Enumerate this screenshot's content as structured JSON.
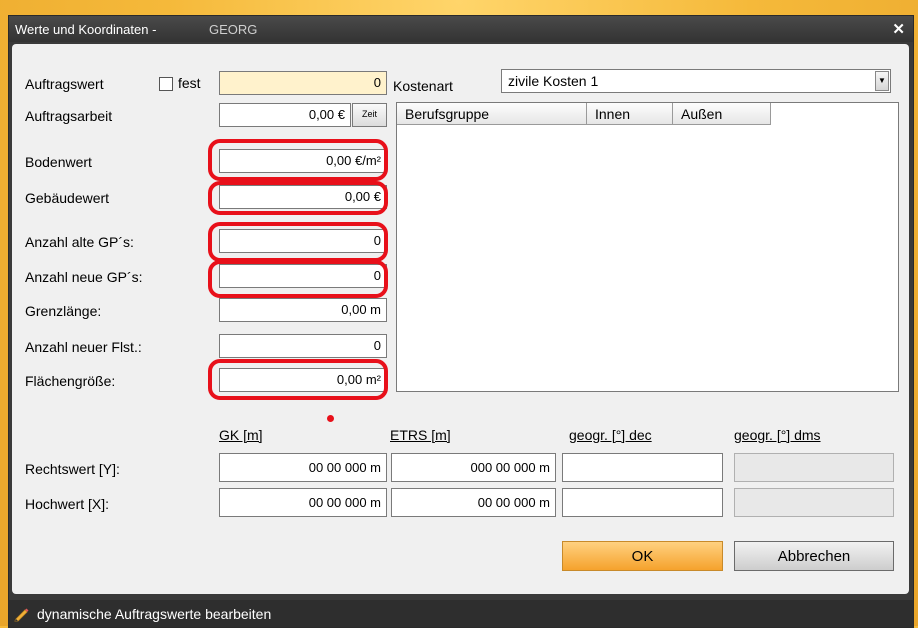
{
  "window": {
    "title": "Werte und Koordinaten -",
    "subtitle": "GEORG",
    "close_icon": "close-icon"
  },
  "fields": {
    "auftragswert": {
      "label": "Auftragswert",
      "fest_label": "fest",
      "value": "0"
    },
    "auftragsarbeit": {
      "label": "Auftragsarbeit",
      "value": "0,00 €",
      "zeit_label": "Zeit"
    },
    "bodenwert": {
      "label": "Bodenwert",
      "value": "0,00 €/m²"
    },
    "gebaeudewert": {
      "label": "Gebäudewert",
      "value": "0,00 €"
    },
    "anzahl_alte": {
      "label": "Anzahl alte GP´s:",
      "value": "0"
    },
    "anzahl_neue": {
      "label": "Anzahl neue GP´s:",
      "value": "0"
    },
    "grenzlaenge": {
      "label": "Grenzlänge:",
      "value": "0,00 m"
    },
    "anzahl_flst": {
      "label": "Anzahl neuer Flst.:",
      "value": "0"
    },
    "flaechengroesse": {
      "label": "Flächengröße:",
      "value": "0,00 m²"
    }
  },
  "kostenart": {
    "label": "Kostenart",
    "selected": "zivile Kosten 1"
  },
  "table": {
    "columns": [
      "Berufsgruppe",
      "Innen",
      "Außen"
    ],
    "rows": []
  },
  "coords": {
    "headers": {
      "gk": "GK [m]",
      "etrs": "ETRS [m]",
      "geo_dec": "geogr. [°] dec",
      "geo_dms": "geogr. [°] dms"
    },
    "rechtswert": {
      "label": "Rechtswert [Y]:",
      "gk": "00 00 000 m",
      "etrs": "000 00 000 m",
      "geo_dec": "",
      "geo_dms": ""
    },
    "hochwert": {
      "label": "Hochwert [X]:",
      "gk": "00 00 000 m",
      "etrs": "00 00 000 m",
      "geo_dec": "",
      "geo_dms": ""
    }
  },
  "buttons": {
    "ok": "OK",
    "cancel": "Abbrechen"
  },
  "status": {
    "text": "dynamische Auftragswerte bearbeiten",
    "icon": "pencil-icon"
  },
  "colors": {
    "highlight": "#e8101a",
    "ok_button": "#f5a22c",
    "background": "#f5b93a"
  }
}
